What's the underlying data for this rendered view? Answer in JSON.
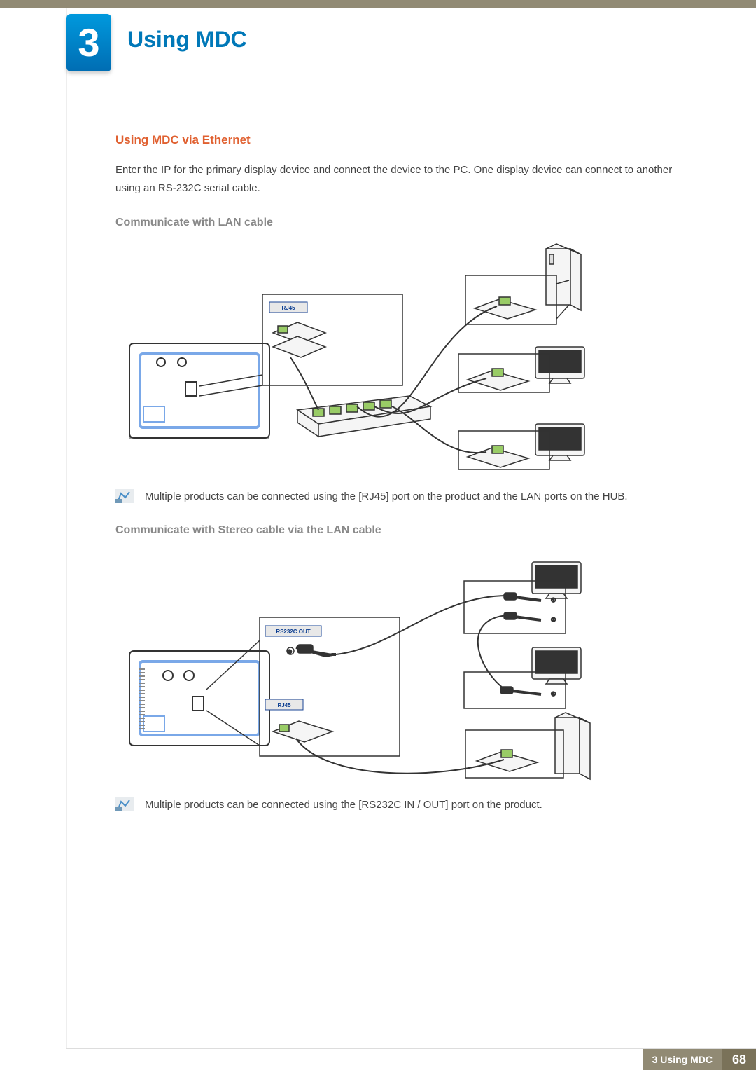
{
  "chapter": {
    "number": "3",
    "title": "Using MDC"
  },
  "section1": {
    "heading": "Using MDC via Ethernet",
    "body": "Enter the IP for the primary display device and connect the device to the PC. One display device can connect to another using an RS-232C serial cable."
  },
  "sub1": {
    "heading": "Communicate with LAN cable",
    "diagram_labels": {
      "rj45": "RJ45"
    },
    "note": "Multiple products can be connected using the [RJ45] port on the product and the LAN ports on the HUB."
  },
  "sub2": {
    "heading": "Communicate with Stereo cable via the LAN cable",
    "diagram_labels": {
      "rs232c_out": "RS232C OUT",
      "rj45": "RJ45"
    },
    "note": "Multiple products can be connected using the [RS232C IN / OUT] port on the product."
  },
  "footer": {
    "label": "3 Using MDC",
    "page": "68"
  }
}
